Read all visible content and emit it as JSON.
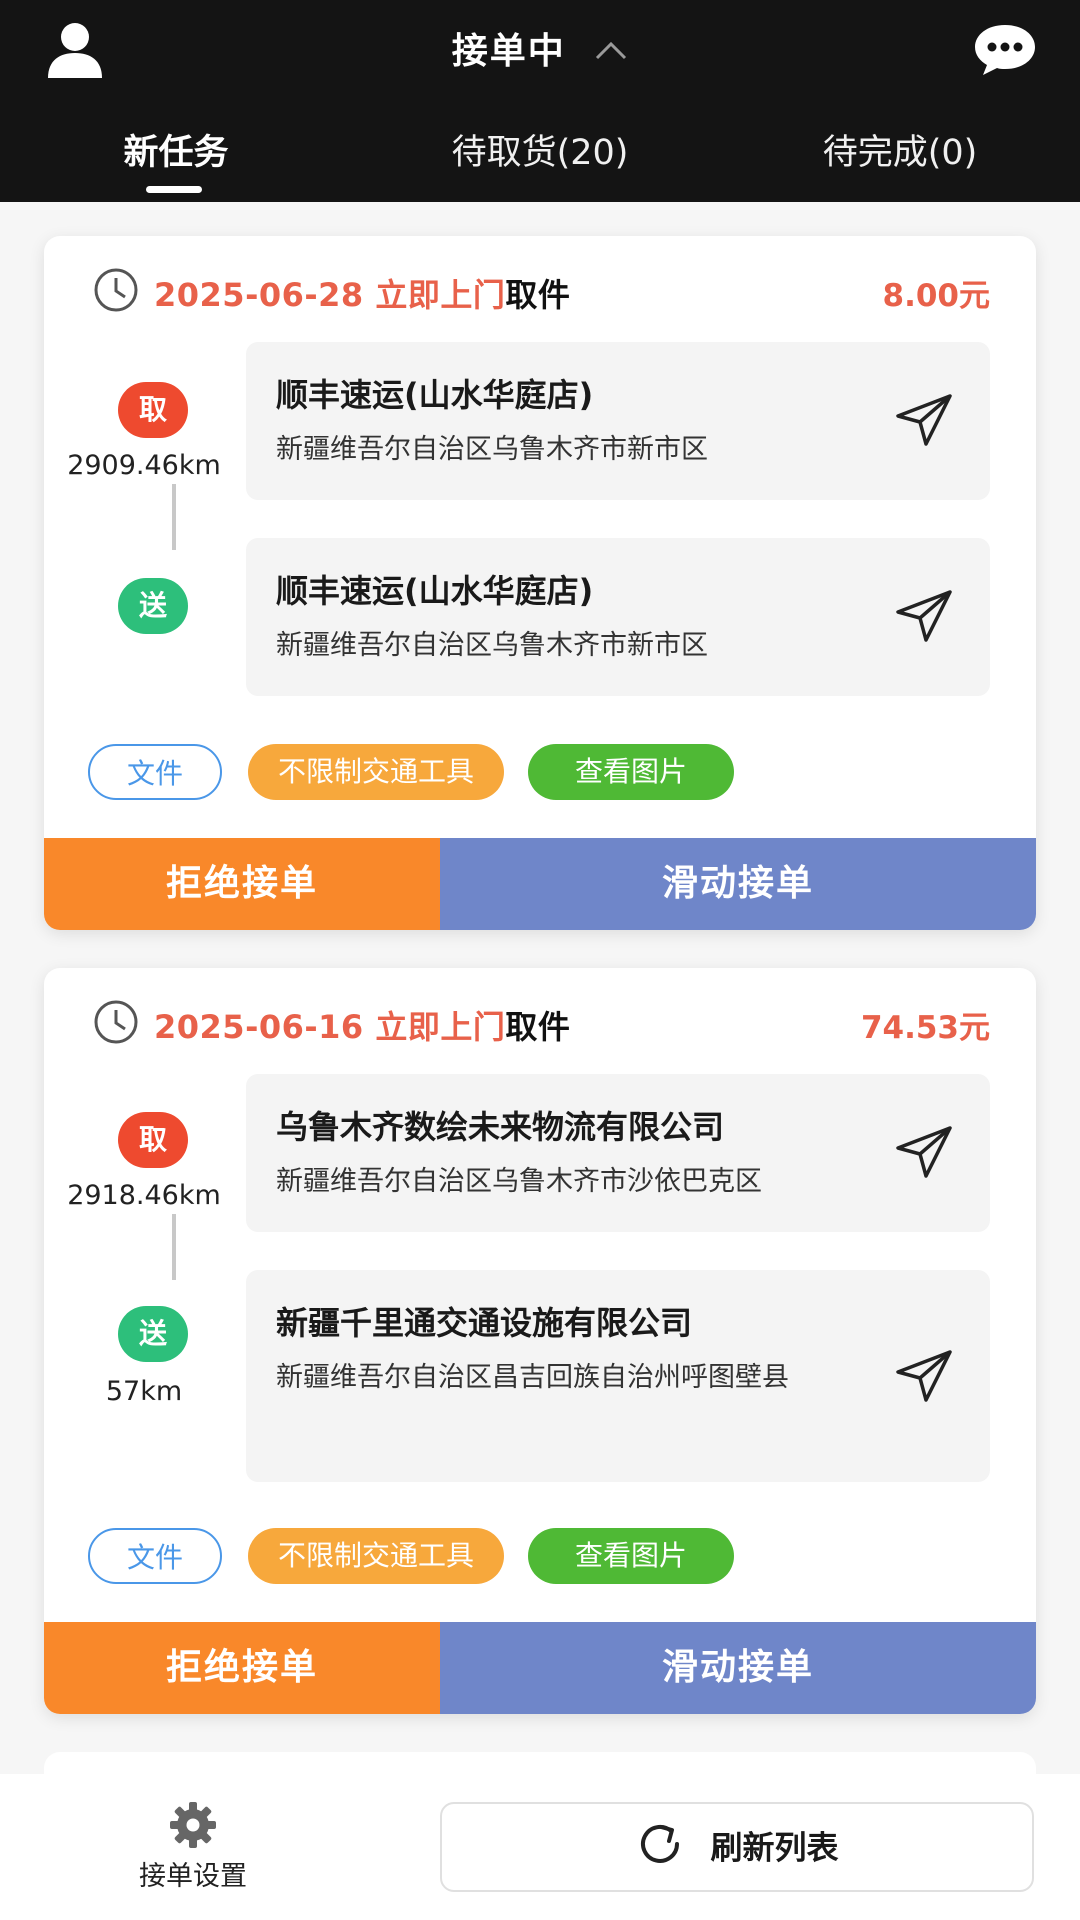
{
  "header": {
    "title": "接单中",
    "tabs": [
      {
        "label": "新任务"
      },
      {
        "label": "待取货(20)"
      },
      {
        "label": "待完成(0)"
      }
    ]
  },
  "orders": [
    {
      "date_text": "2025-06-28 立即上门",
      "date_tail": "取件",
      "price": "8.00元",
      "pickup": {
        "badge": "取",
        "distance": "2909.46km",
        "name": "顺丰速运(山水华庭店)",
        "address": "新疆维吾尔自治区乌鲁木齐市新市区"
      },
      "dropoff": {
        "badge": "送",
        "distance": "",
        "name": "顺丰速运(山水华庭店)",
        "address": "新疆维吾尔自治区乌鲁木齐市新市区"
      },
      "tags": [
        "文件",
        "不限制交通工具",
        "查看图片"
      ],
      "reject_label": "拒绝接单",
      "accept_label": "滑动接单"
    },
    {
      "date_text": "2025-06-16 立即上门",
      "date_tail": "取件",
      "price": "74.53元",
      "pickup": {
        "badge": "取",
        "distance": "2918.46km",
        "name": "乌鲁木齐数绘未来物流有限公司",
        "address": "新疆维吾尔自治区乌鲁木齐市沙依巴克区"
      },
      "dropoff": {
        "badge": "送",
        "distance": "57km",
        "name": "新疆千里通交通设施有限公司",
        "address": "新疆维吾尔自治区昌吉回族自治州呼图壁县"
      },
      "tags": [
        "文件",
        "不限制交通工具",
        "查看图片"
      ],
      "reject_label": "拒绝接单",
      "accept_label": "滑动接单"
    }
  ],
  "footer": {
    "settings_label": "接单设置",
    "refresh_label": "刷新列表"
  },
  "icons": {
    "user": "user-icon",
    "chat": "chat-bubble-icon",
    "clock": "clock-icon",
    "nav": "send-arrow-icon",
    "gear": "gear-icon",
    "refresh": "refresh-icon",
    "chevron": "chevron-up-icon"
  },
  "colors": {
    "header_bg": "#141414",
    "price_red": "#e8614a",
    "pick_badge": "#ee4a2f",
    "drop_badge": "#2dbf7b",
    "reject_orange": "#f9882a",
    "accept_blue": "#6f86c9",
    "tag_blue": "#4a97e8",
    "tag_orange": "#f7a83c",
    "tag_green": "#4fb935"
  }
}
